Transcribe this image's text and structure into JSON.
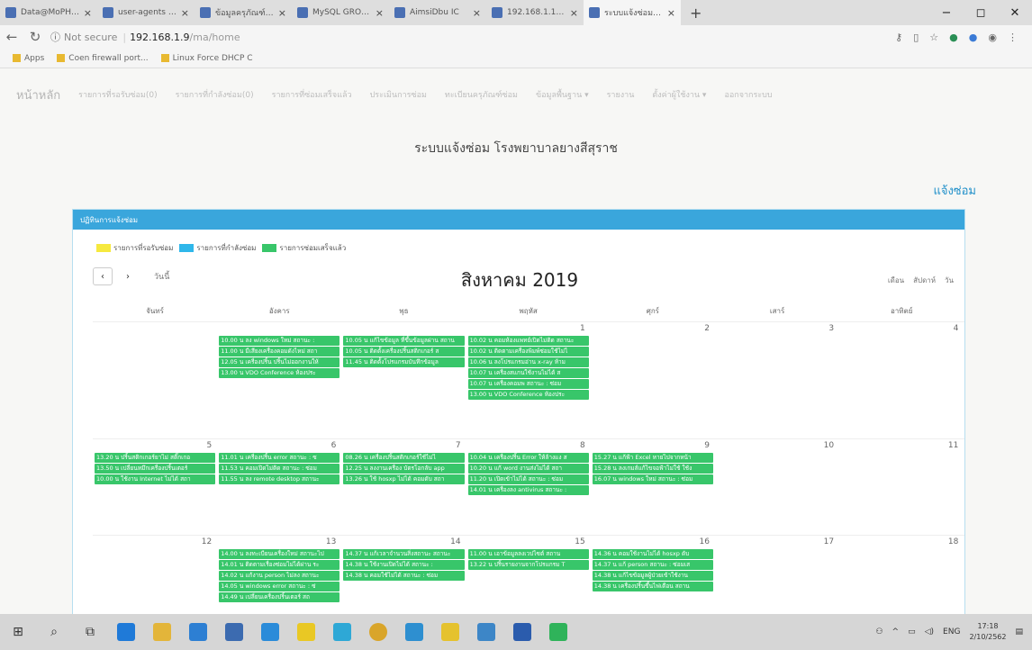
{
  "browser": {
    "tabs": [
      {
        "title": "Data@MoPH From",
        "active": false
      },
      {
        "title": "user-agents - npm",
        "active": false
      },
      {
        "title": "ข้อมูลครุภัณฑ์intagem",
        "active": false
      },
      {
        "title": "MySQL GROUP_CO",
        "active": false
      },
      {
        "title": "AimsiDbu IC",
        "active": false
      },
      {
        "title": "192.168.1.196",
        "active": false
      },
      {
        "title": "ระบบแจ้งซ่อม โรงพย",
        "active": true
      }
    ],
    "new_tab": "+",
    "window_controls": {
      "minimize": "−",
      "maximize": "◻",
      "close": "✕"
    },
    "address": {
      "security": "Not secure",
      "host": "192.168.1.9",
      "path": "/ma/home"
    },
    "bookmarks": [
      "Apps",
      "Coen firewall port...",
      "Linux Force DHCP C"
    ]
  },
  "nav": {
    "home": "หน้าหลัก",
    "items": [
      "รายการที่รอรับซ่อม(0)",
      "รายการที่กำลังซ่อม(0)",
      "รายการที่ซ่อมเสร็จแล้ว",
      "ประเมินการซ่อม",
      "ทะเบียนครุภัณฑ์ซ่อม",
      "ข้อมูลพื้นฐาน ▾",
      "รายงาน",
      "ตั้งค่าผู้ใช้งาน ▾",
      "ออกจากระบบ"
    ]
  },
  "site_title": "ระบบแจ้งซ่อม โรงพยาบาลยางสีสุราช",
  "report_link": "แจ้งซ่อม",
  "panel": {
    "heading": "ปฏิทินการแจ้งซ่อม",
    "legend": [
      {
        "label": "รายการที่รอรับซ่อม",
        "color": "#f6e93f"
      },
      {
        "label": "รายการที่กำลังซ่อม",
        "color": "#2fb7ea"
      },
      {
        "label": "รายการซ่อมเสร็จแล้ว",
        "color": "#38c66a"
      }
    ]
  },
  "calendar": {
    "prev": "‹",
    "next": "›",
    "today": "วันนี้",
    "title": "สิงหาคม 2019",
    "views": [
      "เดือน",
      "สัปดาห์",
      "วัน"
    ],
    "dows": [
      "จันทร์",
      "อังคาร",
      "พุธ",
      "พฤหัส",
      "ศุกร์",
      "เสาร์",
      "อาทิตย์"
    ],
    "weeks": [
      {
        "days": [
          {
            "num": "",
            "events": []
          },
          {
            "num": "",
            "events": [
              "10.00 น ลง windows ใหม่ สถานะ :",
              "11.00 น มีเสียงเครื่องคอมดังไหม่ สถา",
              "12.05 น เครื่องปริ้น ปริ้นไม่ออกงานให้",
              "13.00 น VDO Conference ห้องประ"
            ]
          },
          {
            "num": "",
            "events": [
              "10.05 น แก้ไขข้อมูล ที่ขึ้นข้อมูลผ่าน สถาน",
              "10.05 น ติดตั้งเครื่องปริ้นสติกเกอร์ ส",
              "11.45 น ติดตั้งโปรแกรมบันทึกข้อมูล"
            ]
          },
          {
            "num": "1",
            "events": [
              "10.02 น คอมห้องแพทย์เปิดไม่ติด สถานะ",
              "10.02 น ติดตามเครื่องพิมพ์ซ่อมใช้ไม่ไ",
              "10.06 น ลงโปรแกรมอ่าน x-ray ห้าม",
              "10.07 น เครื่องสแกนใช้งานไม่ได้ ส",
              "10.07 น เครื่องคอมพ สถานะ : ซ่อม",
              "13.00 น VDO Conference ห้องประ"
            ]
          },
          {
            "num": "2",
            "events": []
          },
          {
            "num": "3",
            "events": []
          },
          {
            "num": "4",
            "events": []
          }
        ]
      },
      {
        "days": [
          {
            "num": "5",
            "events": [
              "13.20 น ปริ้นสติกเกอร์ยาไม่ สติ๊กเกอ",
              "13.50 น เปลี่ยนหมึกเครื่องปริ้นเตอร์",
              "10.00 น ใช้งาน Internet ไม่ได้ สถา"
            ]
          },
          {
            "num": "6",
            "events": [
              "11.01 น เครื่องปริ้น error สถานะ : ซ",
              "11.53 น คอมเปิดไม่ติด สถานะ : ซ่อม",
              "11.55 น ลง remote desktop สถานะ"
            ]
          },
          {
            "num": "7",
            "events": [
              "08.26 น เครื่องปริ้นสติกเกอร์ใช้ไม่ไ",
              "12.25 น ลงงานเครื่อง บัตรโอกลับ app",
              "13.26 น ใช้ hosxp ไม่ได้ คอมดับ สถา"
            ]
          },
          {
            "num": "8",
            "events": [
              "10.04 น เครื่องปริ้น Error ให้ล้างแง ส",
              "10.20 น แก้ word งานส่งไม่ได้ สถา",
              "11.20 น เปิดเข้าไม่ได้ สถานะ : ซ่อม",
              "14.01 น เครื่องลง antivirus สถานะ :"
            ]
          },
          {
            "num": "9",
            "events": [
              "15.27 น แก้ฟ้า Excel หายไปจากหน้า",
              "15.28 น ลงเกมส์แก้ไขจอฟ้าไม่ใช้ ใช้ง",
              "16.07 น windows ใหม่ สถานะ : ซ่อม"
            ]
          },
          {
            "num": "10",
            "events": []
          },
          {
            "num": "11",
            "events": []
          }
        ]
      },
      {
        "days": [
          {
            "num": "12",
            "events": []
          },
          {
            "num": "13",
            "events": [
              "14.00 น ลงทะเบียนเครื่องใหม่ สถานะไป",
              "14.01 น ติดตามเรื่องซ่อมไม่ได้ผ่าน ระ",
              "14.02 น แก้งาน person ไม่ลง สถานะ",
              "14.05 น windows error สถานะ : ซ่",
              "14.49 น เปลี่ยนเครื่องปริ้นเตอร์ สถ"
            ]
          },
          {
            "num": "14",
            "events": [
              "14.37 น แก้เวลาจำนวนสิ่งสถานะ สถานะ",
              "14.38 น ใช้งานเปิดไม่ได้ สถานะ :",
              "14.38 น คอมใช้ไม่ได้ สถานะ : ซ่อม"
            ]
          },
          {
            "num": "15",
            "events": [
              "11.00 น เอาข้อมูลลงเวปไซต์ สถาน",
              "13.22 น ปริ้นรายงานจากโปรแกรม T"
            ]
          },
          {
            "num": "16",
            "events": [
              "14.36 น คอมใช้งานไม่ได้ hosxp ดับ",
              "14.37 น แก้ person สถานะ : ซ่อมเส",
              "14.38 น แก้ไขข้อมูลผู้ป่วยเข้าใช้งาน",
              "14.38 น เครื่องปริ้นขึ้นไฟเตือน สถาน"
            ]
          },
          {
            "num": "17",
            "events": []
          },
          {
            "num": "18",
            "events": []
          }
        ]
      }
    ]
  },
  "taskbar": {
    "language": "ENG",
    "time": "17:18",
    "date": "2/10/2562"
  }
}
